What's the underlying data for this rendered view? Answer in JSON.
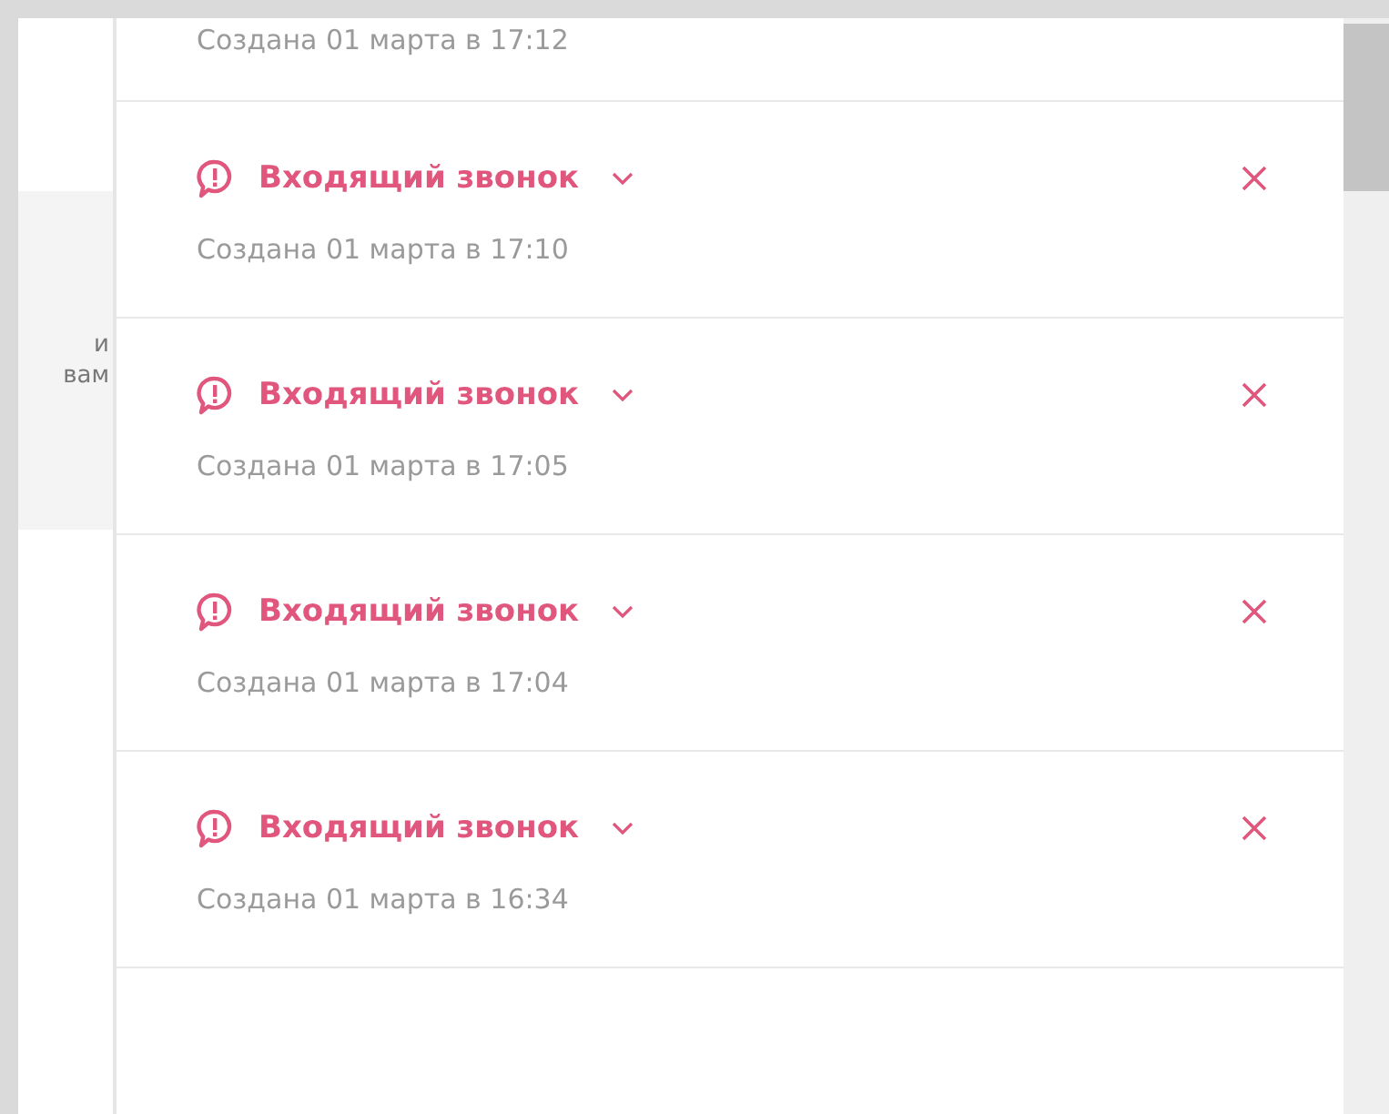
{
  "left_panel": {
    "text_lines": [
      "и",
      "вам"
    ]
  },
  "notifications": [
    {
      "kind": "partial",
      "subtitle": "Создана 01 марта в 17:12"
    },
    {
      "kind": "full",
      "title": "Входящий звонок",
      "subtitle": "Создана 01 марта в 17:10"
    },
    {
      "kind": "full",
      "title": "Входящий звонок",
      "subtitle": "Создана 01 марта в 17:05"
    },
    {
      "kind": "full",
      "title": "Входящий звонок",
      "subtitle": "Создана 01 марта в 17:04"
    },
    {
      "kind": "full",
      "title": "Входящий звонок",
      "subtitle": "Создана 01 марта в 16:34"
    }
  ]
}
